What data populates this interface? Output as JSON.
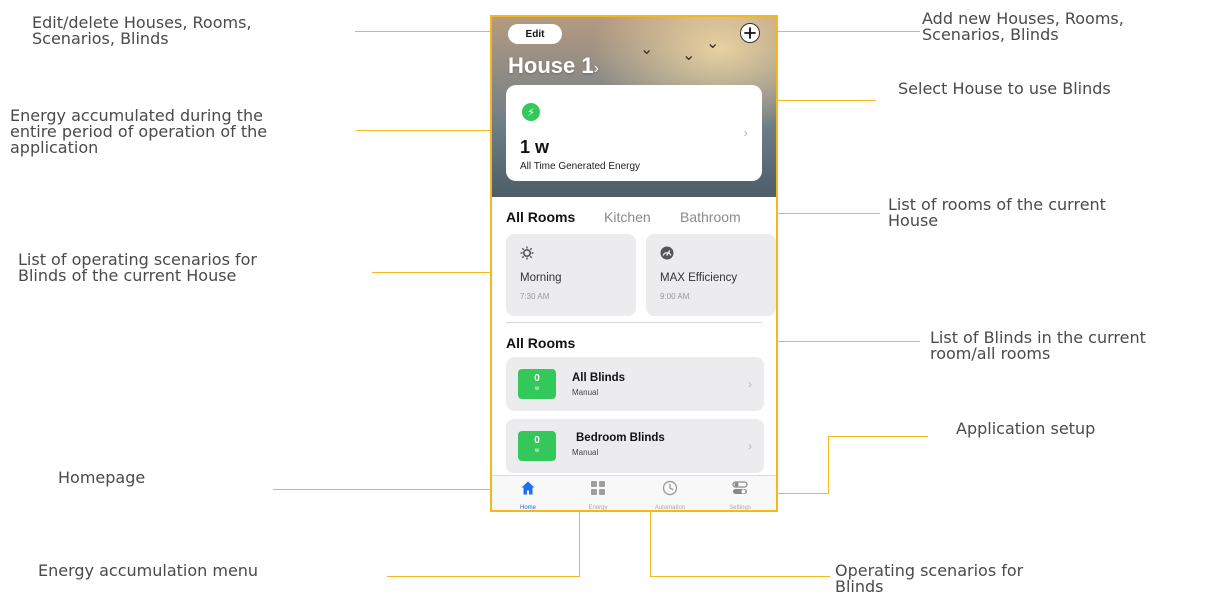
{
  "annotations": {
    "edit": "Edit/delete Houses, Rooms,\nScenarios, Blinds",
    "add": "Add new Houses, Rooms,\nScenarios, Blinds",
    "select_house": "Select House to use Blinds",
    "energy_total": "Energy accumulated during the\nentire period of operation of the\napplication",
    "rooms_list": "List of rooms of the current\nHouse",
    "scenarios_list": "List of operating scenarios for\nBlinds of the current House",
    "blinds_list": "List of Blinds in the current\nroom/all rooms",
    "app_setup": "Application setup",
    "homepage": "Homepage",
    "energy_menu": "Energy accumulation menu",
    "operating_scenarios": "Operating scenarios for\nBlinds"
  },
  "app": {
    "edit_label": "Edit",
    "add_icon": "plus-icon",
    "house_title": "House 1",
    "house_chevron": "›",
    "energy_card": {
      "value": "1 w",
      "label": "All Time Generated Energy",
      "icon": "lightning-bolt-icon"
    },
    "room_tabs": [
      "All Rooms",
      "Kitchen",
      "Bathroom"
    ],
    "active_room_tab": 0,
    "scenarios": [
      {
        "name": "Morning",
        "time": "7:30 AM",
        "icon": "sun-icon"
      },
      {
        "name": "MAX Efficiency",
        "time": "9:00 AM",
        "icon": "speedometer-icon"
      }
    ],
    "section_title": "All Rooms",
    "blinds": [
      {
        "name": "All Blinds",
        "mode": "Manual",
        "value": "0",
        "unit": "w"
      },
      {
        "name": "Bedroom Blinds",
        "mode": "Manual",
        "value": "0",
        "unit": "w"
      }
    ],
    "tabbar": [
      {
        "label": "Home",
        "icon": "home-icon",
        "active": true
      },
      {
        "label": "Energy",
        "icon": "grid-icon",
        "active": false
      },
      {
        "label": "Automation",
        "icon": "clock-icon",
        "active": false
      },
      {
        "label": "Settings",
        "icon": "toggles-icon",
        "active": false
      }
    ]
  },
  "colors": {
    "callout_line": "#f5b81c",
    "accent_green": "#34c759",
    "active_blue": "#1f6ef2"
  }
}
